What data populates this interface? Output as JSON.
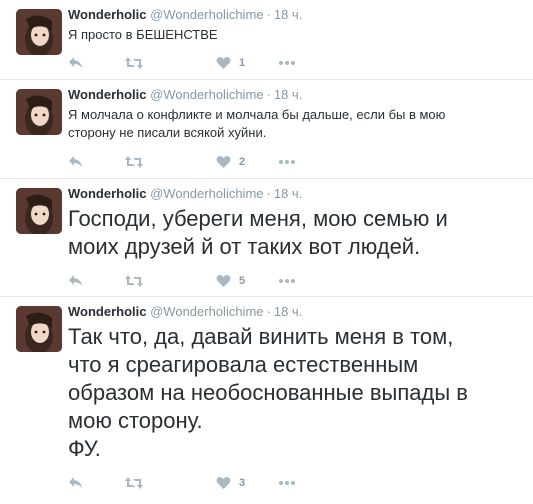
{
  "tweets": [
    {
      "name": "Wonderholic",
      "handle": "@Wonderholichime",
      "time": "18 ч.",
      "lines": [
        "Я просто в БЕШЕНСТВЕ"
      ],
      "likes": "1"
    },
    {
      "name": "Wonderholic",
      "handle": "@Wonderholichime",
      "time": "18 ч.",
      "lines": [
        "Я молчала о конфликте и молчала бы дальше, если бы в мою",
        "сторону не писали всякой хуйни."
      ],
      "likes": "2"
    },
    {
      "name": "Wonderholic",
      "handle": "@Wonderholichime",
      "time": "18 ч.",
      "lines": [
        "Господи, убереги меня, мою семью и",
        "моих друзей й от таких вот людей."
      ],
      "likes": "5"
    },
    {
      "name": "Wonderholic",
      "handle": "@Wonderholichime",
      "time": "18 ч.",
      "lines": [
        "Так что, да, давай винить меня в том,",
        "что я среагировала естественным",
        "образом на необоснованные выпады в",
        "мою сторону.",
        "ФУ."
      ],
      "likes": "3"
    }
  ],
  "colors": {
    "text": "#292f33",
    "muted": "#8899a6",
    "icon": "#aab8c2",
    "divider": "#e1e8ed"
  },
  "icons": {
    "reply": "reply-icon",
    "retweet": "retweet-icon",
    "like": "heart-icon",
    "more": "more-icon"
  }
}
